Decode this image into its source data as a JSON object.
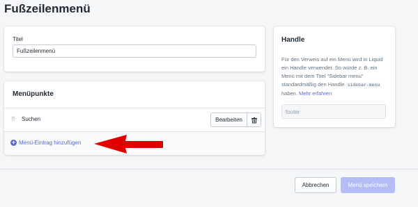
{
  "page": {
    "title": "Fußzeilenmenü"
  },
  "title_card": {
    "label": "Titel",
    "value": "Fußzeilenmenü"
  },
  "menu_items_card": {
    "heading": "Menüpunkte",
    "items": [
      {
        "name": "Suchen",
        "edit_label": "Bearbeiten"
      }
    ],
    "add_label": "Menü-Eintrag hinzufügen"
  },
  "handle_card": {
    "heading": "Handle",
    "desc_part1": "Für den Verweis auf ein Menü wird in Liquid ein Handle verwendet. So würde z. B. ein Menü mit dem Titel \"Sidebar menu\" standardmäßig den Handle",
    "code": "sidebar-menu",
    "desc_part2": "haben.",
    "link": "Mehr erfahren",
    "input_value": "footer"
  },
  "footer": {
    "cancel_label": "Abbrechen",
    "save_label": "Menü speichern"
  },
  "colors": {
    "accent": "#5c6ac4",
    "arrow": "#e00000",
    "primary_disabled": "#b3bcf5"
  }
}
